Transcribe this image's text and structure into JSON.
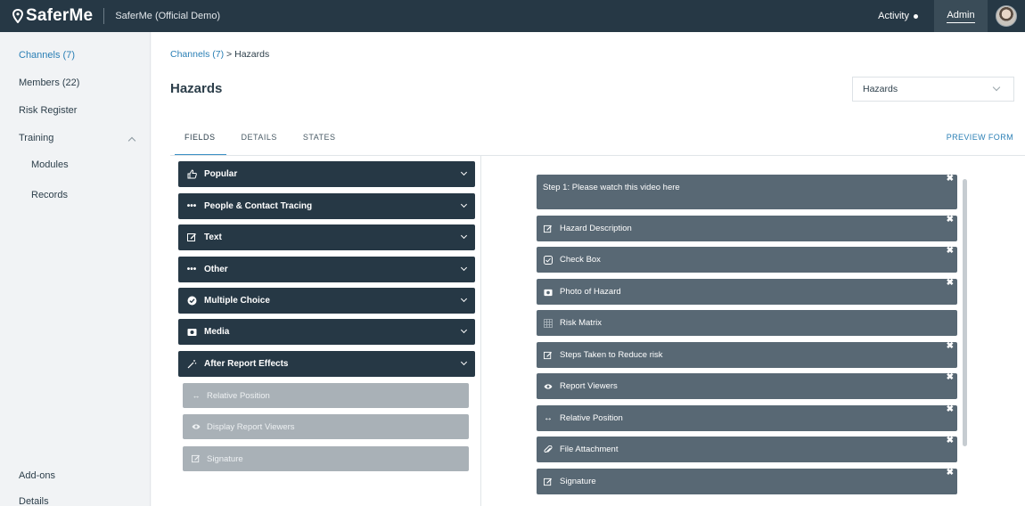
{
  "topbar": {
    "logo": "SaferMe",
    "org_name": "SaferMe (Official Demo)",
    "activity": "Activity",
    "admin": "Admin"
  },
  "sidebar": {
    "channels": "Channels (7)",
    "members": "Members (22)",
    "risk_register": "Risk Register",
    "training": "Training",
    "modules": "Modules",
    "records": "Records",
    "addons": "Add-ons",
    "details": "Details"
  },
  "main": {
    "breadcrumb_link": "Channels (7)",
    "breadcrumb_sep": ">",
    "breadcrumb_current": "Hazards",
    "title": "Hazards",
    "select_value": "Hazards",
    "tabs": [
      "FIELDS",
      "DETAILS",
      "STATES"
    ],
    "preview": "PREVIEW FORM"
  },
  "palette": {
    "categories": [
      {
        "label": "Popular",
        "icon": "thumbs-up-icon"
      },
      {
        "label": "People & Contact Tracing",
        "icon": "dots-icon"
      },
      {
        "label": "Text",
        "icon": "edit-icon"
      },
      {
        "label": "Other",
        "icon": "dots-icon"
      },
      {
        "label": "Multiple Choice",
        "icon": "check-circle-icon"
      },
      {
        "label": "Media",
        "icon": "camera-icon"
      },
      {
        "label": "After Report Effects",
        "icon": "magic-wand-icon"
      }
    ],
    "sub_items": [
      {
        "label": "Relative Position",
        "icon": "arrows-h-icon"
      },
      {
        "label": "Display Report Viewers",
        "icon": "eye-icon"
      },
      {
        "label": "Signature",
        "icon": "edit-icon"
      }
    ]
  },
  "form": {
    "fields": [
      {
        "label": "Step 1: Please watch this video here"
      },
      {
        "label": "Hazard Description",
        "icon": "edit-icon"
      },
      {
        "label": "Check Box",
        "icon": "checkbox-icon"
      },
      {
        "label": "Photo of Hazard",
        "icon": "camera-icon"
      },
      {
        "label": "Risk Matrix",
        "icon": "grid-icon"
      },
      {
        "label": "Steps Taken to Reduce risk",
        "icon": "edit-icon"
      },
      {
        "label": "Report Viewers",
        "icon": "eye-icon"
      },
      {
        "label": "Relative Position",
        "icon": "arrows-h-icon"
      },
      {
        "label": "File Attachment",
        "icon": "paperclip-icon"
      },
      {
        "label": "Signature",
        "icon": "edit-icon"
      }
    ],
    "close_glyph": "✖"
  }
}
